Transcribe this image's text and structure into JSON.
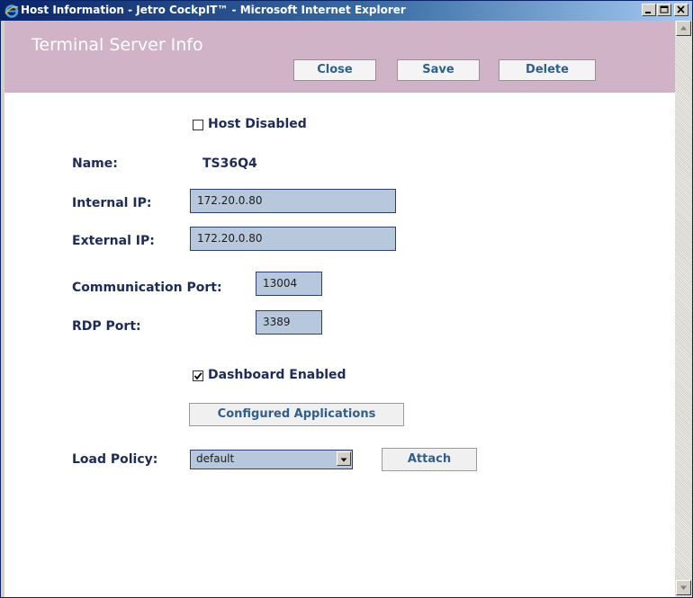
{
  "window": {
    "title": "Host Information - Jetro CockpIT™ - Microsoft Internet Explorer",
    "icon": "ie-icon",
    "controls": {
      "minimize": "minimize-icon",
      "maximize": "maximize-icon",
      "close": "close-icon"
    }
  },
  "header": {
    "title": "Terminal Server Info",
    "close_label": "Close",
    "save_label": "Save",
    "delete_label": "Delete",
    "background": "#d1b3c8"
  },
  "form": {
    "host_disabled": {
      "label": "Host Disabled",
      "checked": false
    },
    "name": {
      "label": "Name:",
      "value": "TS36Q4"
    },
    "internal_ip": {
      "label": "Internal IP:",
      "value": "172.20.0.80"
    },
    "external_ip": {
      "label": "External IP:",
      "value": "172.20.0.80"
    },
    "communication_port": {
      "label": "Communication Port:",
      "value": "13004"
    },
    "rdp_port": {
      "label": "RDP Port:",
      "value": "3389"
    },
    "dashboard_enabled": {
      "label": "Dashboard Enabled",
      "checked": true
    },
    "configured_applications_label": "Configured Applications",
    "load_policy": {
      "label": "Load Policy:",
      "selected": "default"
    },
    "attach_label": "Attach"
  },
  "colors": {
    "label_text": "#1c2b5a",
    "button_text": "#2e5f8e",
    "input_bg": "#b8c8dc"
  }
}
